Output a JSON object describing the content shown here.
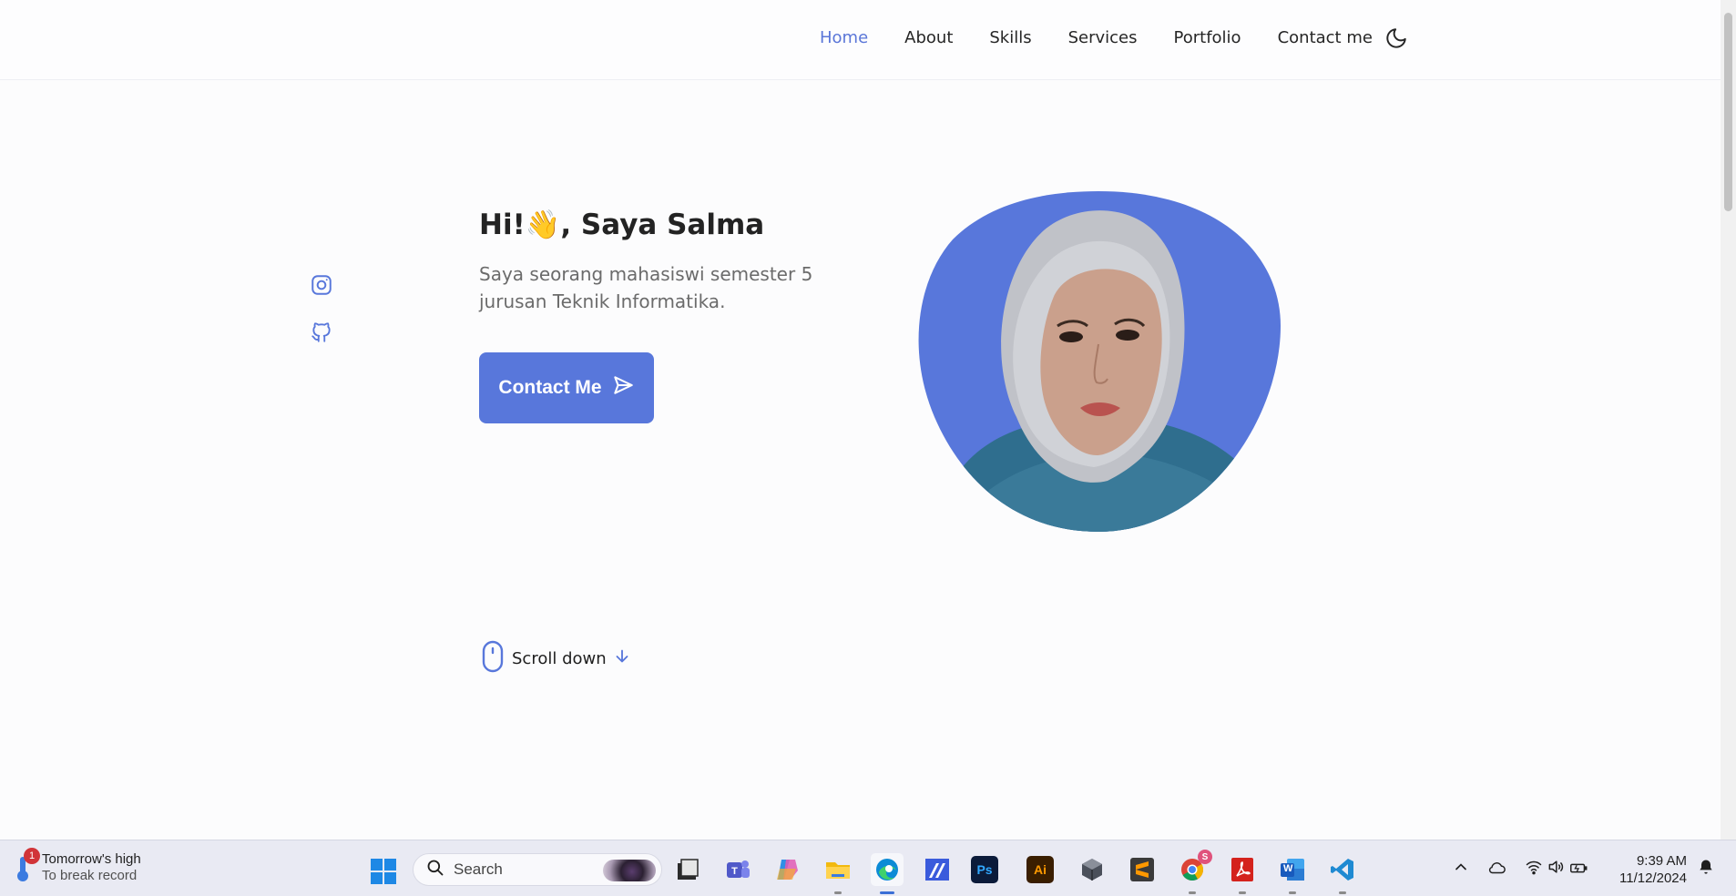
{
  "nav": {
    "items": [
      {
        "label": "Home",
        "active": true
      },
      {
        "label": "About"
      },
      {
        "label": "Skills"
      },
      {
        "label": "Services"
      },
      {
        "label": "Portfolio"
      },
      {
        "label": "Contact me"
      }
    ],
    "theme_toggle_icon": "moon-icon"
  },
  "social": {
    "icons": [
      "instagram-icon",
      "github-icon"
    ]
  },
  "hero": {
    "greeting": "Hi!",
    "emoji": "👋",
    "name": ", Saya Salma",
    "description": "Saya seorang mahasiswi semester 5 jurusan Teknik Informatika.",
    "cta_label": "Contact Me",
    "cta_icon": "send-icon",
    "scroll_label": "Scroll down",
    "accent_color": "#5877db"
  },
  "taskbar": {
    "weather_badge": "1",
    "weather_title": "Tomorrow's high",
    "weather_subtitle": "To break record",
    "search_placeholder": "Search",
    "apps": [
      "file-explorer-icon",
      "teams-icon",
      "copilot-icon",
      "folder-icon",
      "edge-icon",
      "app-icon",
      "photoshop-icon",
      "illustrator-icon",
      "box-icon",
      "sublime-icon",
      "chrome-icon",
      "acrobat-icon",
      "word-icon",
      "vscode-icon"
    ],
    "chrome_badge": "S",
    "ps_label": "Ps",
    "ai_label": "Ai",
    "word_label": "W",
    "time": "9:39 AM",
    "date": "11/12/2024"
  }
}
